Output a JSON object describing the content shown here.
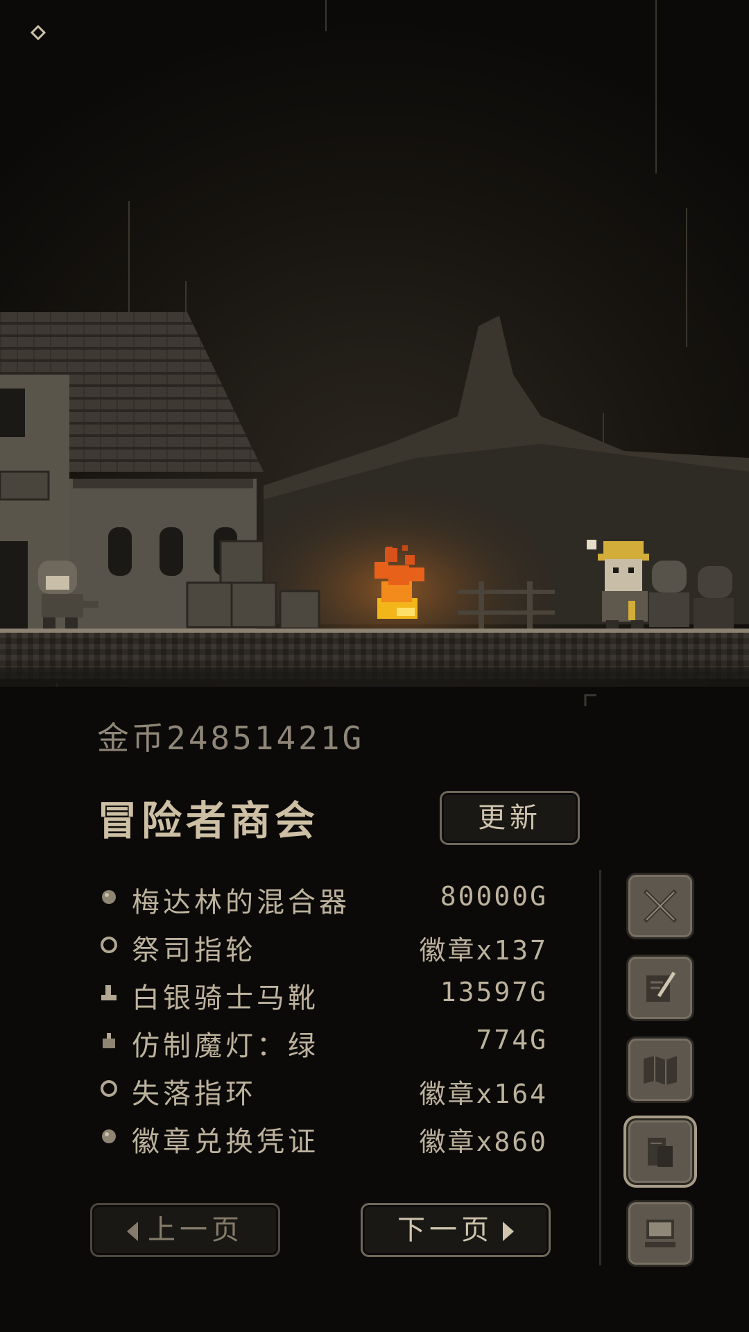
{
  "hud": {
    "gold_label": "金币24851421G",
    "corner_icon": "diamond-icon"
  },
  "shop": {
    "title": "冒险者商会",
    "refresh_label": "更新",
    "items": [
      {
        "name": "梅达林的混合器",
        "price": "80000G",
        "icon": "orb-icon"
      },
      {
        "name": "祭司指轮",
        "price": "徽章x137",
        "icon": "ring-icon"
      },
      {
        "name": "白银骑士马靴",
        "price": "13597G",
        "icon": "boot-icon"
      },
      {
        "name": "仿制魔灯：绿",
        "price": "774G",
        "icon": "lamp-icon"
      },
      {
        "name": "失落指环",
        "price": "徽章x164",
        "icon": "ring-icon"
      },
      {
        "name": "徽章兑换凭证",
        "price": "徽章x860",
        "icon": "orb-icon"
      }
    ],
    "prev_label": "上一页",
    "next_label": "下一页"
  },
  "side_menu": [
    {
      "icon": "crossed-swords-icon",
      "active": false
    },
    {
      "icon": "quill-scroll-icon",
      "active": false
    },
    {
      "icon": "map-icon",
      "active": false
    },
    {
      "icon": "shop-ledger-icon",
      "active": true
    },
    {
      "icon": "computer-icon",
      "active": false
    }
  ],
  "colors": {
    "background": "#0b0a09",
    "text": "#bdb29c",
    "button_bg": "#1a1815",
    "side_button": "#5d574d",
    "fire": "#f07a1e"
  }
}
